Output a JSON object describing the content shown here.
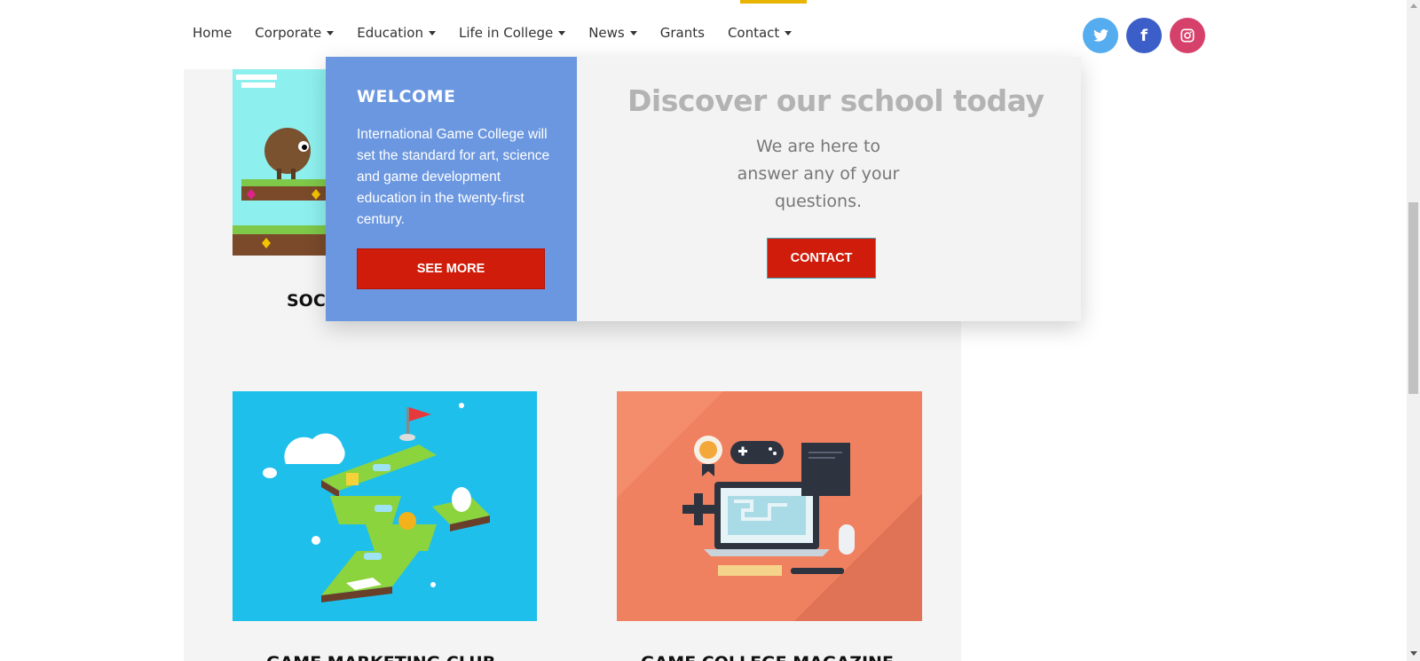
{
  "nav": {
    "items": [
      {
        "label": "Home",
        "dropdown": false
      },
      {
        "label": "Corporate",
        "dropdown": true
      },
      {
        "label": "Education",
        "dropdown": true
      },
      {
        "label": "Life in College",
        "dropdown": true
      },
      {
        "label": "News",
        "dropdown": true
      },
      {
        "label": "Grants",
        "dropdown": false
      },
      {
        "label": "Contact",
        "dropdown": true
      }
    ],
    "active_item": "Contact",
    "social": {
      "twitter": "twitter-icon",
      "facebook": "f",
      "instagram": "instagram-icon"
    }
  },
  "mega_menu": {
    "welcome_title": "WELCOME",
    "welcome_text": "International Game College will set the standard for art, science and game development education in the twenty-first century.",
    "see_more_label": "SEE MORE",
    "discover_title": "Discover our school today",
    "here_text": "We are here to answer any of your questions.",
    "contact_label": "CONTACT"
  },
  "cards": [
    {
      "title": "SOC",
      "image": "platformer-game-illustration"
    },
    {
      "title": "GAME MARKETING CLUB",
      "image": "isometric-level-map-illustration"
    },
    {
      "title": "GAME COLLEGE MAGAZINE",
      "image": "game-dev-workspace-illustration"
    }
  ],
  "colors": {
    "accent_bar": "#e9b400",
    "button_red": "#d01c0a",
    "welcome_blue": "#6b97e0",
    "twitter": "#55acee",
    "facebook": "#3b5ec9",
    "instagram": "#d6416b"
  }
}
